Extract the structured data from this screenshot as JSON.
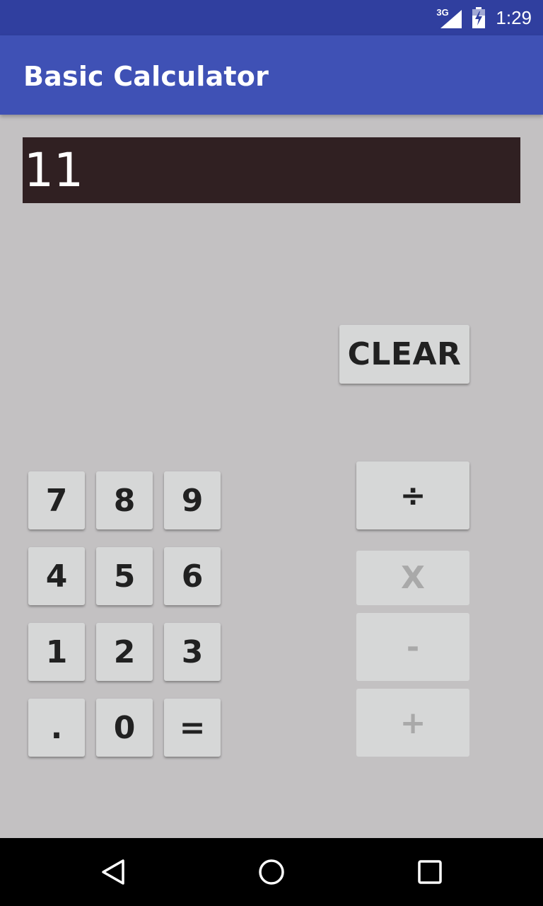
{
  "status_bar": {
    "network_label": "3G",
    "time": "1:29",
    "icons": [
      "signal-icon",
      "battery-charging-icon"
    ]
  },
  "app_bar": {
    "title": "Basic Calculator"
  },
  "display": {
    "value": "11"
  },
  "buttons": {
    "clear": "CLEAR",
    "digits": [
      "7",
      "8",
      "9",
      "4",
      "5",
      "6",
      "1",
      "2",
      "3",
      ".",
      "0",
      "="
    ],
    "operators": {
      "divide": "÷",
      "multiply": "X",
      "subtract": "-",
      "add": "+"
    }
  },
  "nav_bar": {
    "icons": [
      "back-icon",
      "home-icon",
      "recents-icon"
    ]
  },
  "colors": {
    "status_bar": "#303f9f",
    "app_bar": "#3f51b5",
    "background": "#c3c1c2",
    "display_bg": "#302022",
    "button_bg": "#d6d7d7",
    "button_text": "#212121",
    "disabled_text": "#a9a9a9"
  }
}
